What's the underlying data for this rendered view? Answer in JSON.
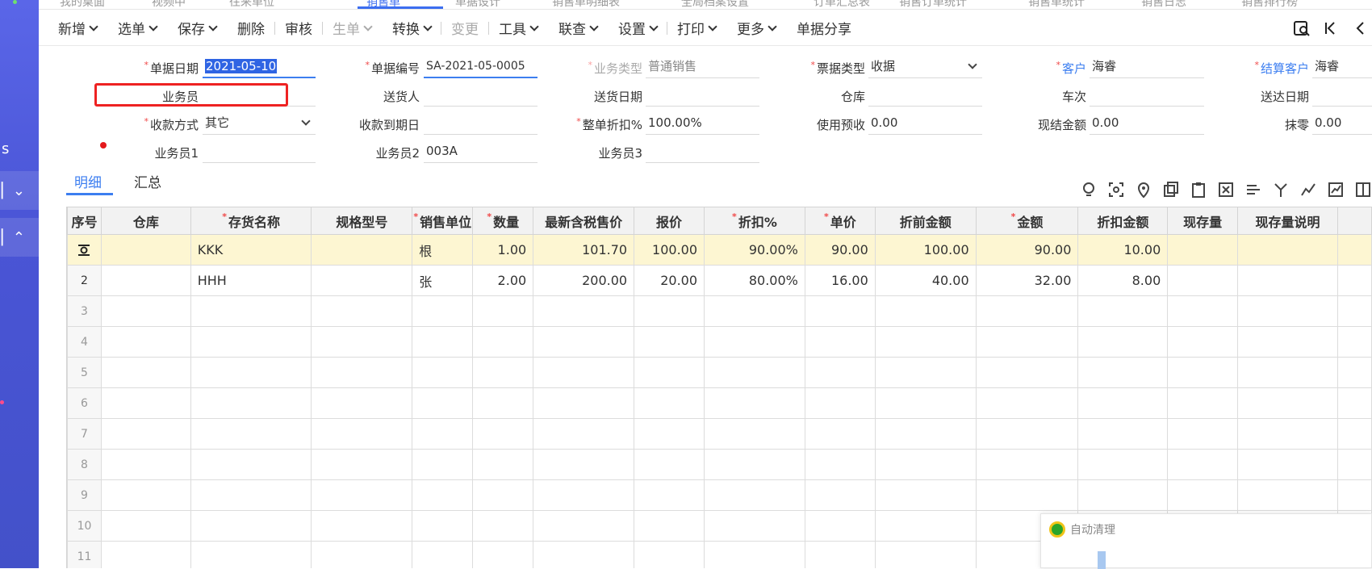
{
  "top_tabs": [
    "我的桌面",
    "视频中",
    "往来单位",
    "销售单",
    "单据设计",
    "销售单明细表",
    "全局档案设置",
    "订单汇总表",
    "销售订单统计",
    "销售单统计",
    "销售日志",
    "销售排行榜"
  ],
  "toolbar": {
    "items": [
      {
        "label": "新增",
        "caret": true,
        "disabled": false
      },
      {
        "label": "选单",
        "caret": true,
        "disabled": false
      },
      {
        "label": "保存",
        "caret": true,
        "disabled": false
      },
      {
        "label": "删除",
        "caret": false,
        "disabled": false,
        "sep": true
      },
      {
        "label": "审核",
        "caret": false,
        "disabled": false,
        "sep": true
      },
      {
        "label": "生单",
        "caret": true,
        "disabled": true
      },
      {
        "label": "转换",
        "caret": true,
        "disabled": false,
        "sep": true
      },
      {
        "label": "变更",
        "caret": false,
        "disabled": true,
        "sep": true
      },
      {
        "label": "工具",
        "caret": true,
        "disabled": false
      },
      {
        "label": "联查",
        "caret": true,
        "disabled": false
      },
      {
        "label": "设置",
        "caret": true,
        "disabled": false,
        "sep": true
      },
      {
        "label": "打印",
        "caret": true,
        "disabled": false
      },
      {
        "label": "更多",
        "caret": true,
        "disabled": false
      },
      {
        "label": "单据分享",
        "caret": false,
        "disabled": false
      }
    ],
    "right_icons": [
      "search-doc-icon",
      "first-page-icon",
      "prev-page-icon"
    ]
  },
  "form": {
    "doc_date_label": "单据日期",
    "doc_date": "2021-05-10",
    "doc_no_label": "单据编号",
    "doc_no": "SA-2021-05-0005",
    "biz_type_label": "业务类型",
    "biz_type": "普通销售",
    "invoice_type_label": "票据类型",
    "invoice_type": "收据",
    "customer_label": "客户",
    "customer": "海睿",
    "settle_customer_label": "结算客户",
    "settle_customer": "海睿",
    "salesman_label": "业务员",
    "salesman": "",
    "shipper_label": "送货人",
    "shipper": "",
    "ship_date_label": "送货日期",
    "ship_date": "",
    "warehouse_label": "仓库",
    "warehouse": "",
    "trip_label": "车次",
    "trip": "",
    "arrive_date_label": "送达日期",
    "arrive_date": "",
    "pay_method_label": "收款方式",
    "pay_method": "其它",
    "due_date_label": "收款到期日",
    "due_date": "",
    "discount_label": "整单折扣%",
    "discount": "100.00%",
    "prepay_label": "使用预收",
    "prepay": "0.00",
    "cash_label": "现结金额",
    "cash": "0.00",
    "round_label": "抹零",
    "round": "0.00",
    "salesman1_label": "业务员1",
    "salesman1": "",
    "salesman2_label": "业务员2",
    "salesman2": "003A",
    "salesman3_label": "业务员3",
    "salesman3": ""
  },
  "sub_tabs": {
    "detail": "明细",
    "summary": "汇总"
  },
  "row_icons": [
    "bulb-icon",
    "scan-icon",
    "location-icon",
    "copy-row-icon",
    "paste-icon",
    "delete-row-icon",
    "batch-icon",
    "split-icon",
    "chart-icon",
    "trend-icon",
    "columns-icon"
  ],
  "grid": {
    "headers": [
      "序号",
      "仓库",
      "存货名称",
      "规格型号",
      "销售单位",
      "数量",
      "最新含税售价",
      "报价",
      "折扣%",
      "单价",
      "折前金额",
      "金额",
      "折扣金额",
      "现存量",
      "现存量说明"
    ],
    "required": [
      false,
      false,
      true,
      false,
      true,
      true,
      false,
      false,
      true,
      true,
      false,
      true,
      false,
      false,
      false
    ],
    "rows": [
      {
        "idx": "",
        "warehouse": "",
        "name": "KKK",
        "spec": "",
        "unit": "根",
        "qty": "1.00",
        "latest_price": "101.70",
        "quote": "100.00",
        "disc": "90.00%",
        "price": "90.00",
        "pre_amount": "100.00",
        "amount": "90.00",
        "disc_amount": "10.00",
        "stock": "",
        "stock_note": ""
      },
      {
        "idx": "2",
        "warehouse": "",
        "name": "HHH",
        "spec": "",
        "unit": "张",
        "qty": "2.00",
        "latest_price": "200.00",
        "quote": "20.00",
        "disc": "80.00%",
        "price": "16.00",
        "pre_amount": "40.00",
        "amount": "32.00",
        "disc_amount": "8.00",
        "stock": "",
        "stock_note": ""
      }
    ],
    "empty_rows": [
      "3",
      "4",
      "5",
      "6",
      "7",
      "8",
      "9",
      "10",
      "11"
    ]
  },
  "popup": {
    "label": "自动清理"
  },
  "sidebar": {
    "text_s": "s"
  },
  "colors": {
    "accent": "#3c7ef0",
    "required": "#f04848",
    "selected_row": "#fdf6d2",
    "sidebar": "#4a55d6"
  }
}
